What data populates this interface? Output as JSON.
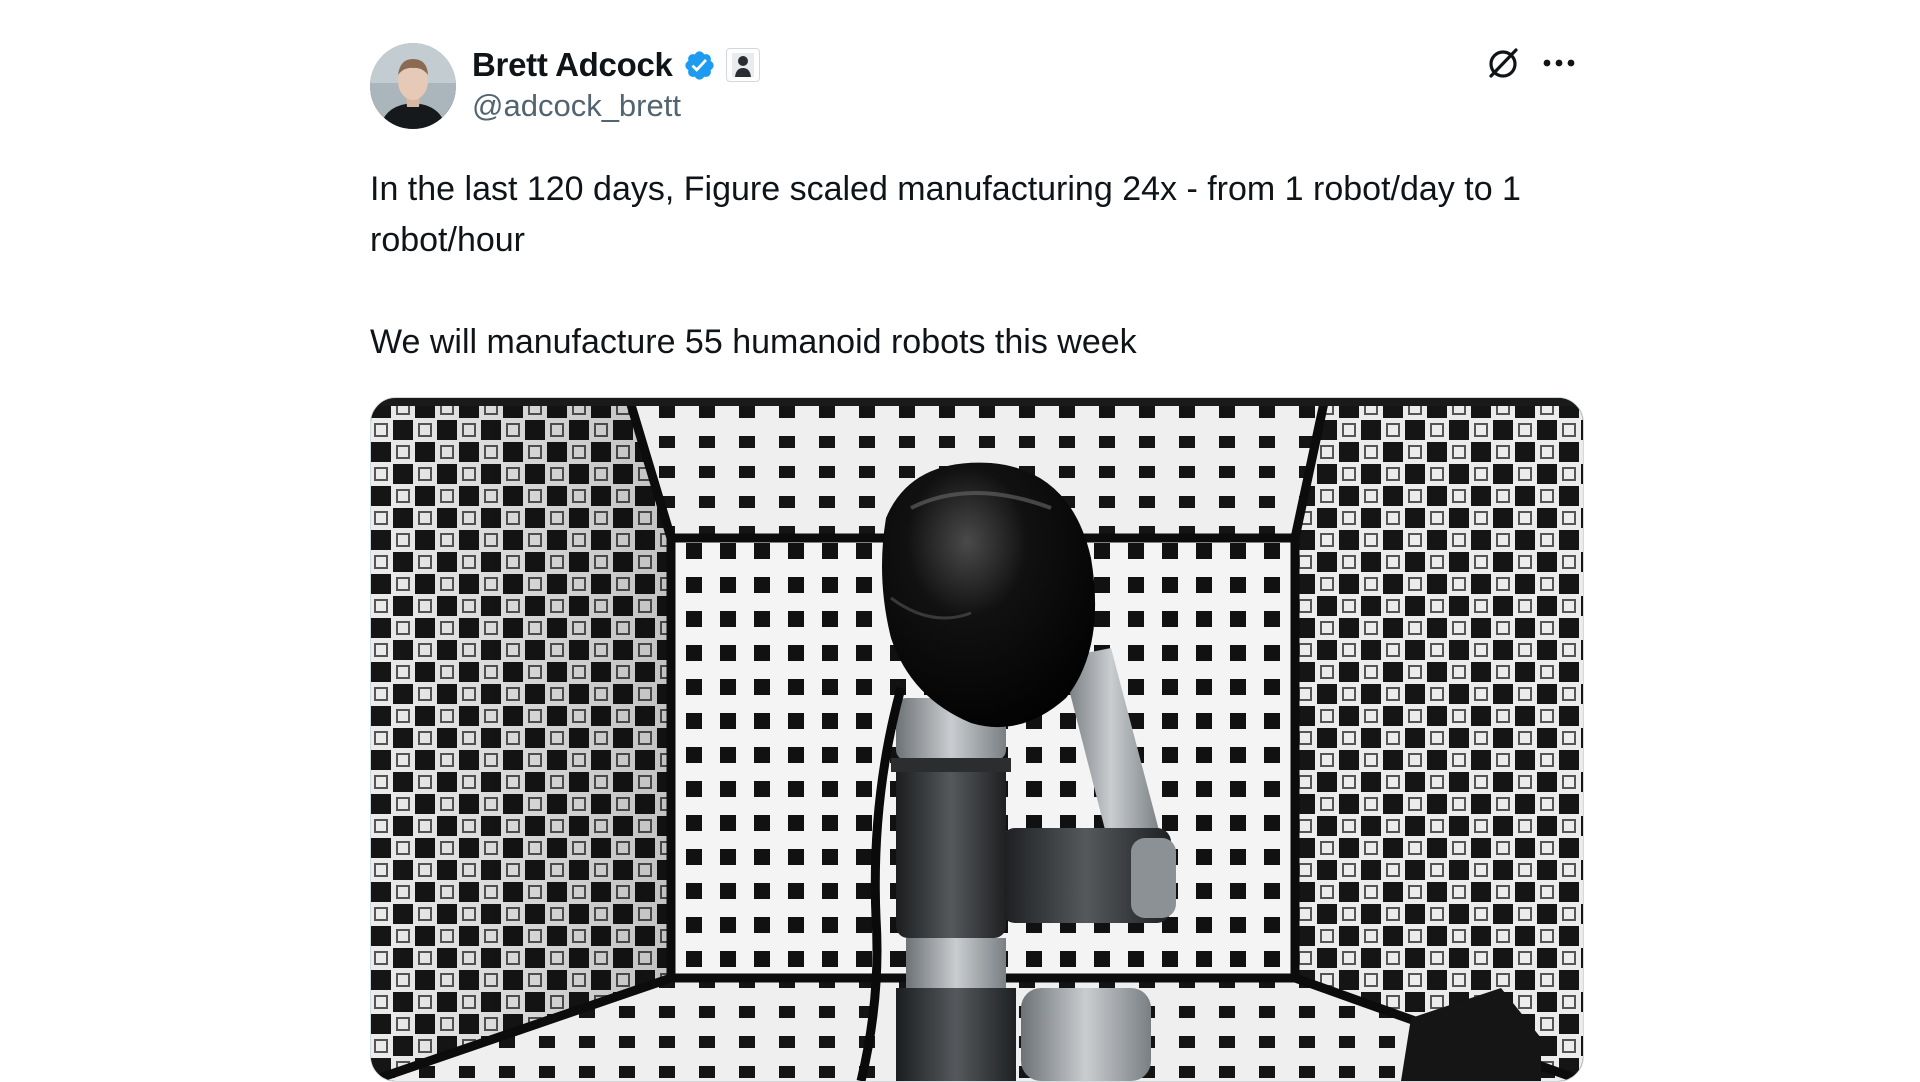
{
  "tweet": {
    "author": {
      "display_name": "Brett Adcock",
      "handle": "@adcock_brett",
      "verified": true,
      "verified_icon": "verified-badge-icon",
      "affiliation_icon": "affiliation-badge-icon"
    },
    "text_line1": "In the last 120 days, Figure scaled manufacturing 24x - from 1 robot/day to 1 robot/hour",
    "text_line2": "We will manufacture 55 humanoid robots this week",
    "actions": {
      "grok_icon": "grok-icon",
      "more_icon": "more-options-icon"
    },
    "media": {
      "type": "image",
      "subject": "humanoid robot head on arm in checkerboard calibration box"
    }
  },
  "colors": {
    "verified_blue": "#1d9bf0",
    "text": "#0f1419",
    "secondary": "#536471"
  }
}
